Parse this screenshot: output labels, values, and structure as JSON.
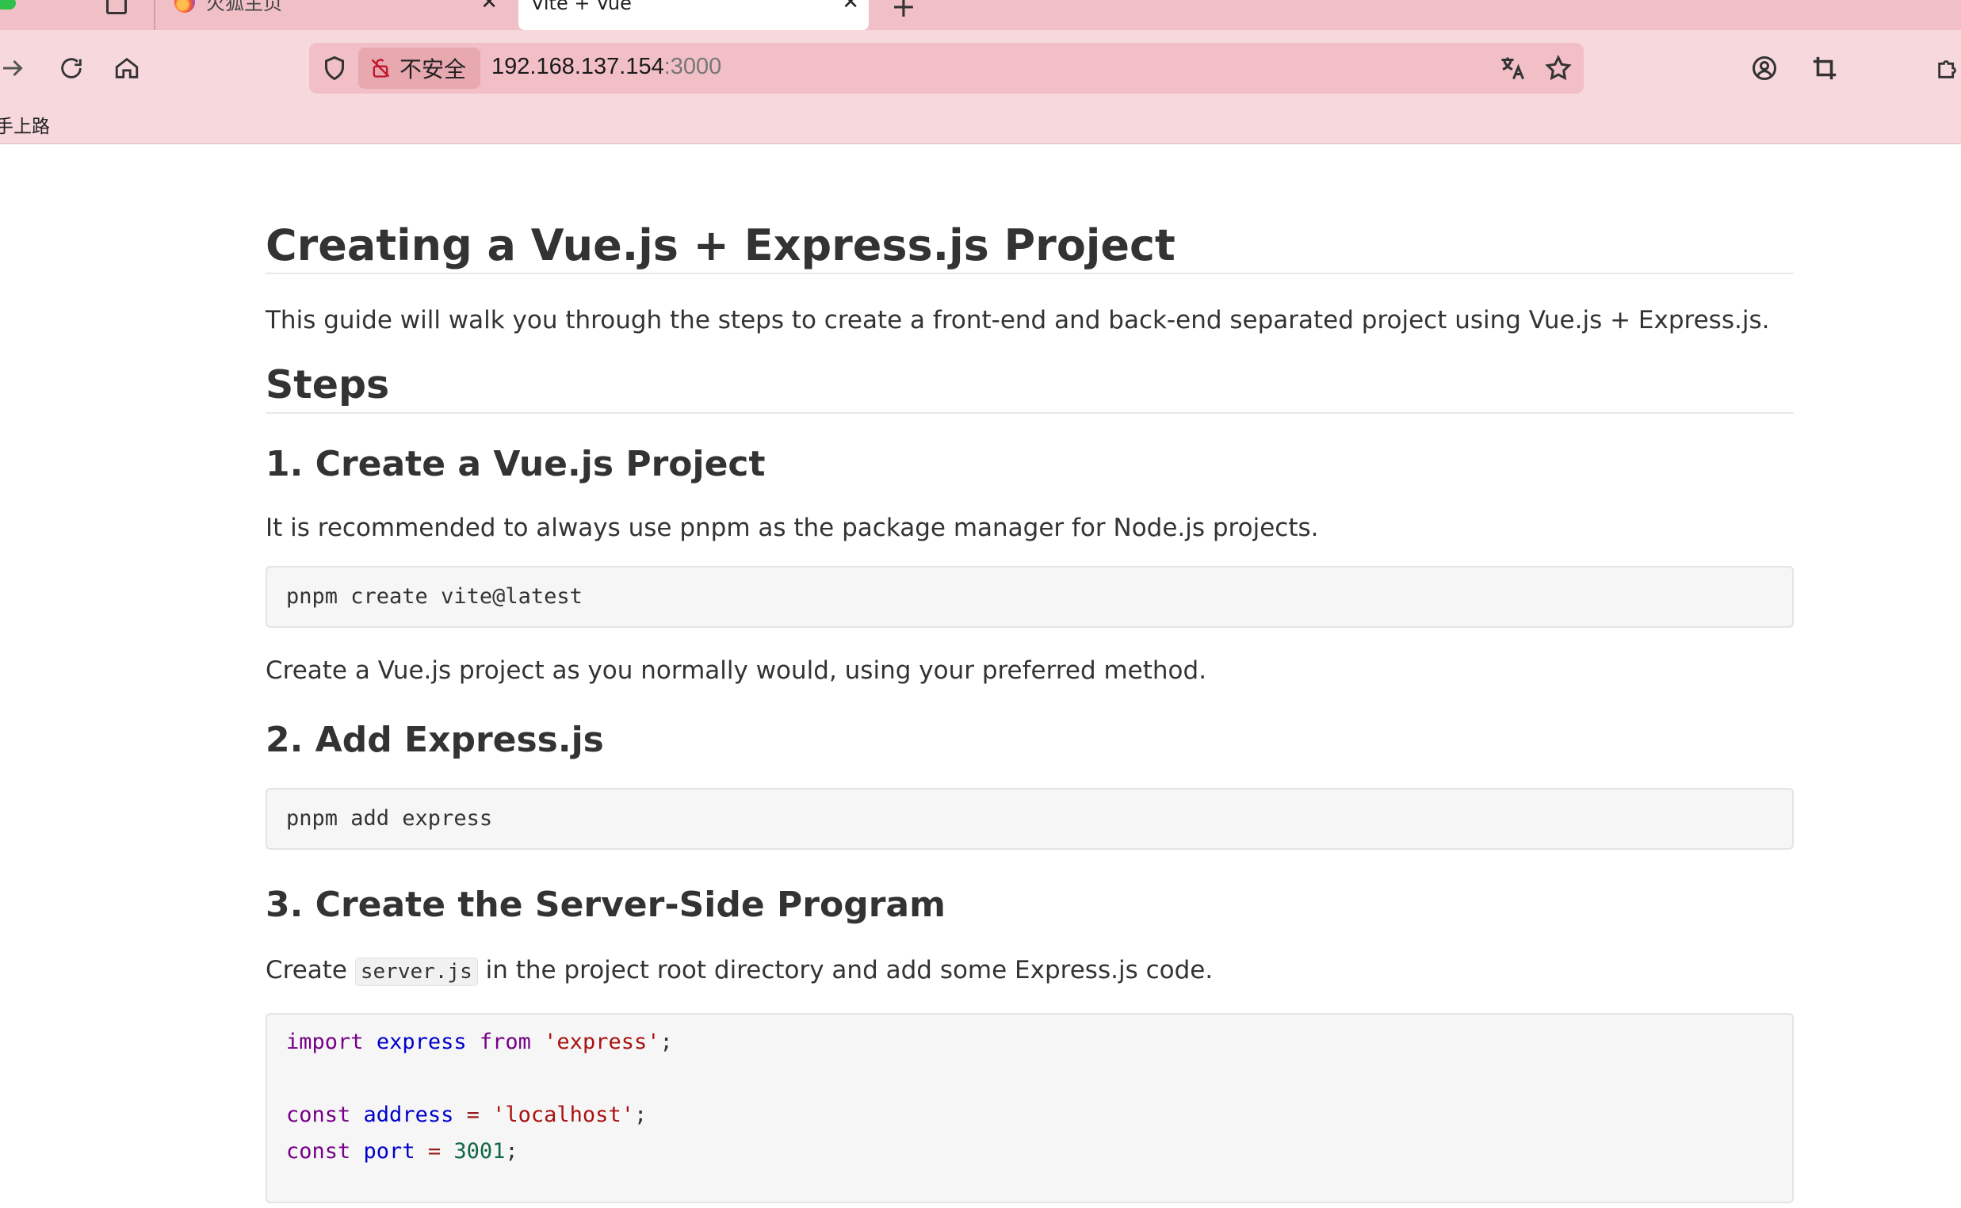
{
  "browser": {
    "tabs": [
      {
        "label": "火狐主页"
      },
      {
        "label": "Vite + Vue",
        "active": true
      }
    ],
    "url": {
      "security_label": "不安全",
      "host": "192.168.137.154",
      "port": ":3000"
    },
    "bookmarks": [
      {
        "label": "手上路"
      }
    ],
    "colors": {
      "chrome": "#f7d8dc",
      "tabstrip": "#f0c0c6",
      "urlbar": "#f2bfc6"
    }
  },
  "page": {
    "title": "Creating a Vue.js + Express.js Project",
    "intro": "This guide will walk you through the steps to create a front-end and back-end separated project using Vue.js + Express.js.",
    "steps_heading": "Steps",
    "step1": {
      "heading": "1. Create a Vue.js Project",
      "text": "It is recommended to always use pnpm as the package manager for Node.js projects.",
      "code": "pnpm create vite@latest",
      "after": "Create a Vue.js project as you normally would, using your preferred method."
    },
    "step2": {
      "heading": "2. Add Express.js",
      "code": "pnpm add express"
    },
    "step3": {
      "heading": "3. Create the Server-Side Program",
      "text_before": "Create ",
      "inline_code": "server.js",
      "text_after": " in the project root directory and add some Express.js code.",
      "code": {
        "l1_kw1": "import",
        "l1_var": "express",
        "l1_kw2": "from",
        "l1_str": "'express'",
        "l1_end": ";",
        "l3_kw": "const",
        "l3_var": "address",
        "l3_op": "=",
        "l3_str": "'localhost'",
        "l3_end": ";",
        "l4_kw": "const",
        "l4_var": "port",
        "l4_op": "=",
        "l4_num": "3001",
        "l4_end": ";"
      }
    }
  }
}
